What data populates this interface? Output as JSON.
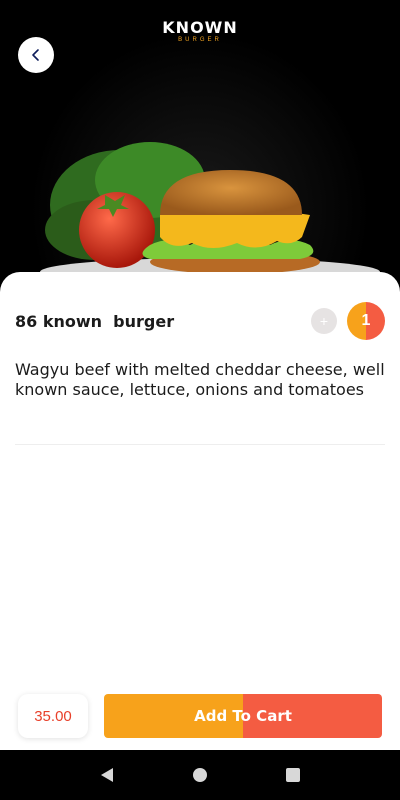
{
  "header": {
    "logo_main": "KNOWN",
    "logo_sub": "BURGER",
    "back_icon": "chevron-left-icon"
  },
  "product": {
    "name": "86 known  burger",
    "description": "Wagyu beef with melted cheddar cheese, well known sauce, lettuce, onions and tomatoes",
    "quantity": "1",
    "minus_label": "+",
    "price": "35.00"
  },
  "actions": {
    "add_to_cart_label": "Add To Cart"
  },
  "colors": {
    "accent_orange": "#f7a21b",
    "accent_red": "#f45c42",
    "price_red": "#e8402a"
  },
  "navbar": {
    "back": "triangle-back-icon",
    "home": "circle-home-icon",
    "recents": "square-recents-icon"
  }
}
